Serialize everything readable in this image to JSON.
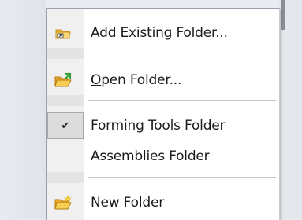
{
  "menu": {
    "items": [
      {
        "label": "Add Existing Folder...",
        "icon": "folder-link-icon"
      },
      {
        "label": "Open Folder...",
        "icon": "folder-open-icon"
      },
      {
        "label": "Forming Tools Folder",
        "icon": "checkmark-icon",
        "checked": true
      },
      {
        "label": "Assemblies Folder",
        "icon": ""
      },
      {
        "label": "New Folder",
        "icon": "folder-new-icon"
      }
    ],
    "check_glyph": "✔"
  },
  "colors": {
    "folder": "#f3c24a",
    "folder_dark": "#c98f1a",
    "green_arrow": "#3aa23a",
    "check_bg": "#dcdcdc"
  }
}
